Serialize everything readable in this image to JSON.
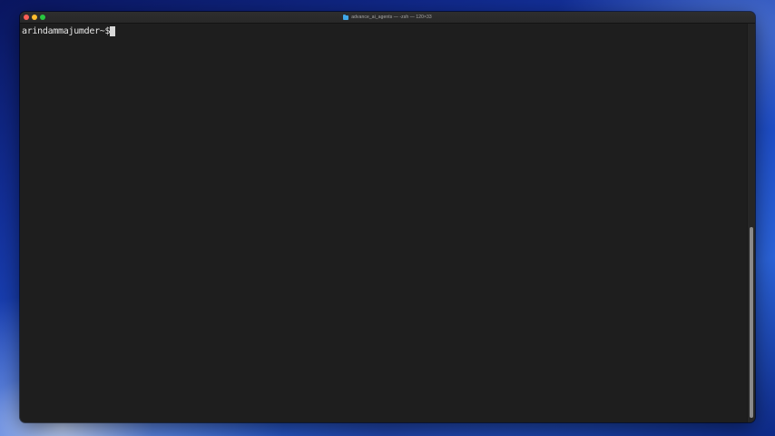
{
  "window": {
    "title": "advance_ai_agents — -zsh — 120×33"
  },
  "terminal": {
    "prompt": "arindammajumder~$"
  },
  "icons": {
    "titlebar": "folder-icon",
    "close": "close-icon",
    "minimize": "minimize-icon",
    "zoom": "zoom-icon"
  },
  "colors": {
    "terminal_background": "#1e1e1e",
    "close": "#fe5f57",
    "minimize": "#febc2e",
    "zoom": "#28c840",
    "folder": "#3fa6e8"
  }
}
